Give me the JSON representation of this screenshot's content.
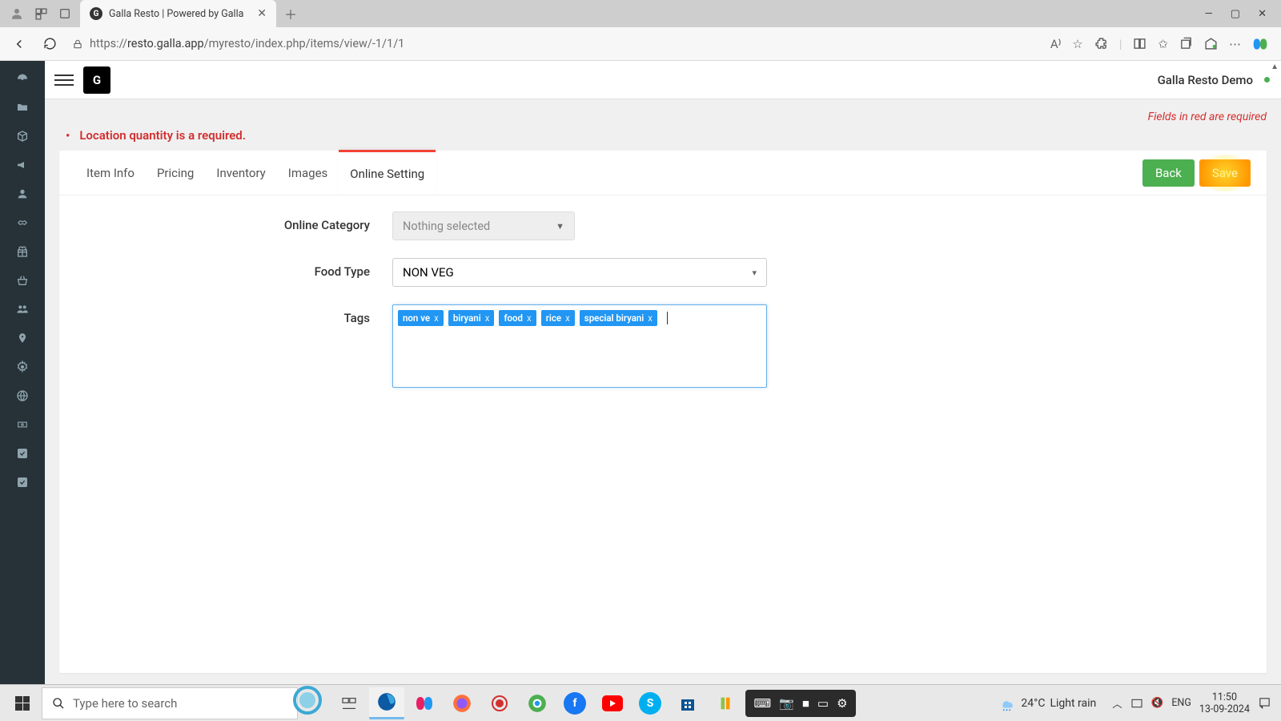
{
  "browser": {
    "tab_title": "Galla Resto | Powered by Galla",
    "url_prefix": "https://",
    "url_host": "resto.galla.app",
    "url_path": "/myresto/index.php/items/view/-1/1/1"
  },
  "header": {
    "user": "Galla Resto Demo"
  },
  "notices": {
    "required_hint": "Fields in red are required",
    "error": "Location quantity is a required."
  },
  "tabs": {
    "items": [
      "Item Info",
      "Pricing",
      "Inventory",
      "Images",
      "Online Setting"
    ],
    "active_index": 4,
    "back_label": "Back",
    "save_label": "Save"
  },
  "form": {
    "online_category_label": "Online Category",
    "online_category_value": "Nothing selected",
    "food_type_label": "Food Type",
    "food_type_value": "NON VEG",
    "tags_label": "Tags",
    "tags": [
      "non ve",
      "biryani",
      "food",
      "rice",
      "special biryani"
    ]
  },
  "taskbar": {
    "search_placeholder": "Type here to search",
    "weather_temp": "24°C",
    "weather_desc": "Light rain",
    "lang": "ENG",
    "time": "11:50",
    "date": "13-09-2024"
  }
}
